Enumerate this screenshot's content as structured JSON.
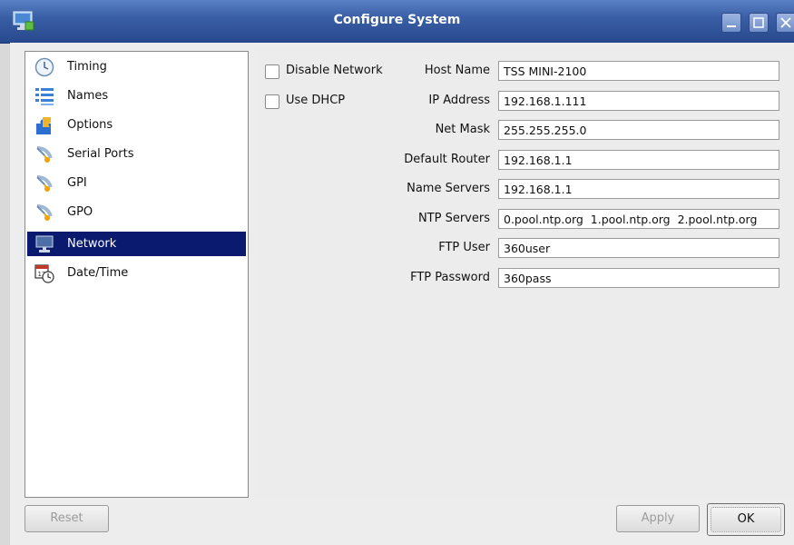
{
  "window": {
    "title": "Configure System"
  },
  "sidebar": {
    "items": [
      {
        "label": "Timing",
        "icon": "clock-icon"
      },
      {
        "label": "Names",
        "icon": "list-icon"
      },
      {
        "label": "Options",
        "icon": "puzzle-icon"
      },
      {
        "label": "Serial Ports",
        "icon": "satellite-icon"
      },
      {
        "label": "GPI",
        "icon": "satellite-icon"
      },
      {
        "label": "GPO",
        "icon": "satellite-icon"
      },
      {
        "label": "Network",
        "icon": "monitor-icon",
        "selected": true
      },
      {
        "label": "Date/Time",
        "icon": "calendar-clock-icon"
      }
    ]
  },
  "network": {
    "disable_network": {
      "label": "Disable Network",
      "checked": false
    },
    "use_dhcp": {
      "label": "Use DHCP",
      "checked": false
    },
    "fields": [
      {
        "label": "Host Name",
        "value": "TSS MINI-2100"
      },
      {
        "label": "IP Address",
        "value": "192.168.1.111"
      },
      {
        "label": "Net Mask",
        "value": "255.255.255.0"
      },
      {
        "label": "Default Router",
        "value": "192.168.1.1"
      },
      {
        "label": "Name Servers",
        "value": "192.168.1.1"
      },
      {
        "label": "NTP Servers",
        "value": "0.pool.ntp.org  1.pool.ntp.org  2.pool.ntp.org"
      },
      {
        "label": "FTP User",
        "value": "360user"
      },
      {
        "label": "FTP Password",
        "value": "360pass"
      }
    ]
  },
  "buttons": {
    "reset": "Reset",
    "apply": "Apply",
    "ok": "OK"
  },
  "colors": {
    "titlebar": "#3a5fa6",
    "selection": "#0a1a6e"
  }
}
